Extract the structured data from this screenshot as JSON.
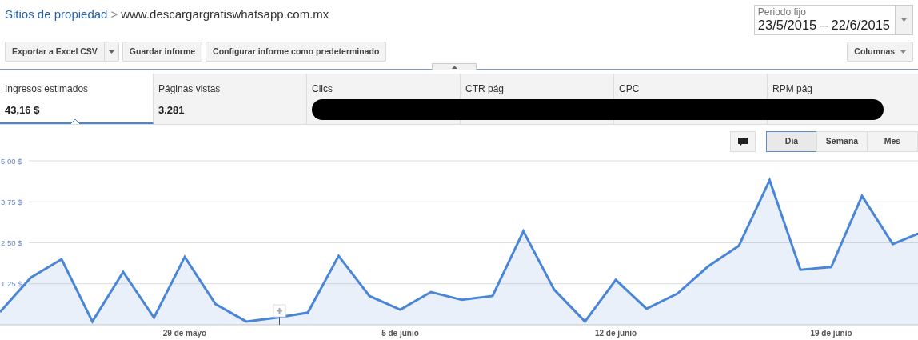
{
  "breadcrumb": {
    "parent": "Sitios de propiedad",
    "separator": ">",
    "current": "www.descargargratiswhatsapp.com.mx"
  },
  "period": {
    "label": "Periodo fijo",
    "value": "23/5/2015 – 22/6/2015"
  },
  "toolbar": [
    {
      "label": "Exportar a Excel CSV",
      "kind": "split"
    },
    {
      "label": "Guardar informe",
      "kind": "plain"
    },
    {
      "label": "Configurar informe como predeterminado",
      "kind": "plain"
    }
  ],
  "columns_button": "Columnas",
  "metrics": [
    {
      "label": "Ingresos estimados",
      "value": "43,16 $",
      "selected": true
    },
    {
      "label": "Páginas vistas",
      "value": "3.281",
      "selected": false
    },
    {
      "label": "Clics",
      "selected": false,
      "redacted": true
    },
    {
      "label": "CTR pág",
      "selected": false,
      "redacted": true
    },
    {
      "label": "CPC",
      "selected": false,
      "redacted": true
    },
    {
      "label": "RPM pág",
      "selected": false,
      "redacted": true
    }
  ],
  "granularity": [
    {
      "label": "Día",
      "selected": true
    },
    {
      "label": "Semana",
      "selected": false
    },
    {
      "label": "Mes",
      "selected": false
    }
  ],
  "chart_data": {
    "type": "area",
    "grid": true,
    "categories": [
      null,
      null,
      null,
      null,
      null,
      null,
      "29 de mayo",
      null,
      null,
      null,
      null,
      null,
      null,
      "5 de junio",
      null,
      null,
      null,
      null,
      null,
      null,
      "12 de junio",
      null,
      null,
      null,
      null,
      null,
      null,
      "19 de junio",
      null,
      null,
      null
    ],
    "series": [
      {
        "color": "#4a86d8",
        "values": [
          0.39,
          1.44,
          2.0,
          0.1,
          1.61,
          0.22,
          2.07,
          0.63,
          0.1,
          0.22,
          0.37,
          2.1,
          0.88,
          0.46,
          1.0,
          0.76,
          0.88,
          2.85,
          1.07,
          0.1,
          1.37,
          0.49,
          0.95,
          1.78,
          2.41,
          4.41,
          1.68,
          1.76,
          3.93,
          2.46,
          2.85
        ]
      }
    ],
    "ylim": [
      0,
      5
    ],
    "yticks": [
      {
        "value": 1.25,
        "label": "1,25 $"
      },
      {
        "value": 2.5,
        "label": "2,50 $"
      },
      {
        "value": 3.75,
        "label": "3,75 $"
      },
      {
        "value": 5,
        "label": "5,00 $"
      }
    ]
  }
}
